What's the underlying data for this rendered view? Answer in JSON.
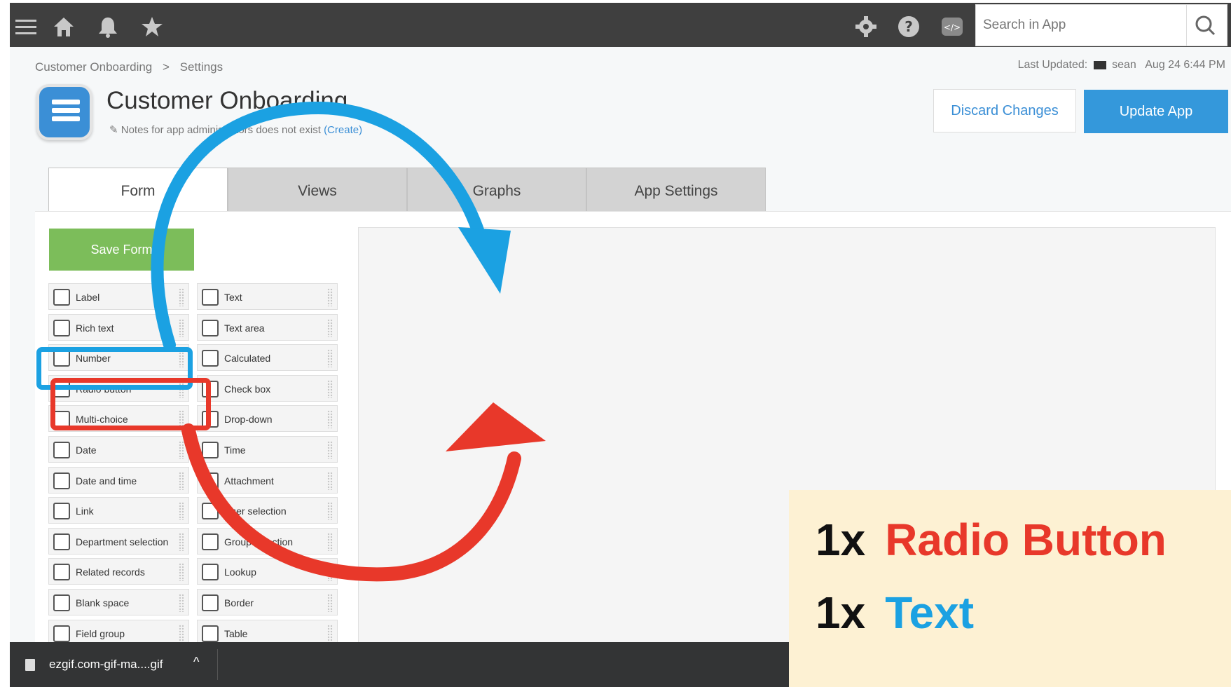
{
  "app": {
    "breadcrumb": [
      "Customer Onboarding",
      ">",
      "Settings"
    ],
    "last_updated_label": "Last Updated:",
    "last_updated_user": "sean",
    "last_updated_time": "Aug 24 6:44 PM",
    "title": "Customer Onboarding",
    "note_text": "Notes for app administrators does not exist",
    "note_link": "(Create)",
    "discard_label": "Discard Changes",
    "update_label": "Update App"
  },
  "search": {
    "placeholder": "Search in App"
  },
  "tabs": [
    {
      "label": "Form",
      "active": true
    },
    {
      "label": "Views",
      "active": false
    },
    {
      "label": "Graphs",
      "active": false
    },
    {
      "label": "App Settings",
      "active": false
    }
  ],
  "form": {
    "save_label": "Save Form",
    "fields_left": [
      "Label",
      "Rich text",
      "Number",
      "Radio button",
      "Multi-choice",
      "Date",
      "Date and time",
      "Link",
      "Department selection",
      "Related records",
      "Blank space",
      "Field group"
    ],
    "fields_right": [
      "Text",
      "Text area",
      "Calculated",
      "Check box",
      "Drop-down",
      "Time",
      "Attachment",
      "User selection",
      "Group selection",
      "Lookup",
      "Border",
      "Table"
    ],
    "icons_left": [
      "tag-icon",
      "rich-text-icon",
      "number-icon",
      "radio-icon",
      "multi-choice-icon",
      "date-icon",
      "datetime-icon",
      "link-icon",
      "department-icon",
      "related-records-icon",
      "blank-space-icon",
      "field-group-icon"
    ],
    "icons_right": [
      "text-icon",
      "text-area-icon",
      "calculated-icon",
      "checkbox-icon",
      "dropdown-icon",
      "time-icon",
      "attachment-icon",
      "user-icon",
      "group-icon",
      "lookup-icon",
      "border-icon",
      "table-icon"
    ]
  },
  "download": {
    "file_name": "ezgif.com-gif-ma....gif",
    "chevron": "^"
  },
  "overlay": {
    "rows": [
      {
        "qty": "1x",
        "name": "Radio Button",
        "color": "#e8382a"
      },
      {
        "qty": "1x",
        "name": "Text",
        "color": "#1ba1e2"
      }
    ]
  },
  "colors": {
    "accent_blue": "#1ba1e2",
    "accent_red": "#e8382a",
    "save_green": "#7cbd5a",
    "update_blue": "#3498db"
  }
}
